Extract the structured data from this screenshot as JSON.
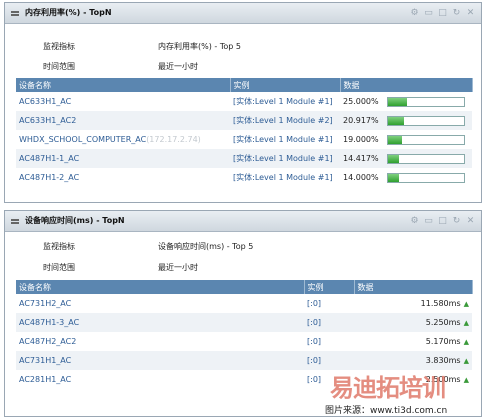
{
  "panel1": {
    "title": "内存利用率(%) - TopN",
    "metric_label": "监视指标",
    "metric_value": "内存利用率(%) - Top 5",
    "range_label": "时间范围",
    "range_value": "最近一小时",
    "headers": [
      "设备名称",
      "实例",
      "数据"
    ],
    "rows": [
      {
        "name": "AC633H1_AC",
        "name_extra": "",
        "instance": "[实体:Level 1 Module #1]",
        "value": "25.000%",
        "fraction": 0.25
      },
      {
        "name": "AC633H1_AC2",
        "name_extra": "",
        "instance": "[实体:Level 1 Module #2]",
        "value": "20.917%",
        "fraction": 0.209
      },
      {
        "name": "WHDX_SCHOOL_COMPUTER_AC",
        "name_extra": "(172.17.2.74)",
        "instance": "[实体:Level 1 Module #1]",
        "value": "19.000%",
        "fraction": 0.19
      },
      {
        "name": "AC487H1-1_AC",
        "name_extra": "",
        "instance": "[实体:Level 1 Module #1]",
        "value": "14.417%",
        "fraction": 0.144
      },
      {
        "name": "AC487H1-2_AC",
        "name_extra": "",
        "instance": "[实体:Level 1 Module #1]",
        "value": "14.000%",
        "fraction": 0.14
      }
    ]
  },
  "panel2": {
    "title": "设备响应时间(ms) - TopN",
    "metric_label": "监视指标",
    "metric_value": "设备响应时间(ms) - Top 5",
    "range_label": "时间范围",
    "range_value": "最近一小时",
    "headers": [
      "设备名称",
      "实例",
      "数据"
    ],
    "rows": [
      {
        "name": "AC731H2_AC",
        "instance": "[:0]",
        "value": "11.580ms"
      },
      {
        "name": "AC487H1-3_AC",
        "instance": "[:0]",
        "value": "5.250ms"
      },
      {
        "name": "AC487H2_AC2",
        "instance": "[:0]",
        "value": "5.170ms"
      },
      {
        "name": "AC731H1_AC",
        "instance": "[:0]",
        "value": "3.830ms"
      },
      {
        "name": "AC281H1_AC",
        "instance": "[:0]",
        "value": "2.500ms"
      }
    ]
  },
  "tool_icons": [
    "gear-icon",
    "window-icon",
    "maximize-icon",
    "refresh-icon",
    "close-icon"
  ],
  "watermark": {
    "brand": "易迪拓培训",
    "source": "图片来源：www.ti3d.com.cn"
  },
  "colors": {
    "header_bg": "#5b86b0",
    "link": "#2d5c95",
    "bar_fill": "#2fa02f",
    "alt_row": "#eef2f6"
  }
}
